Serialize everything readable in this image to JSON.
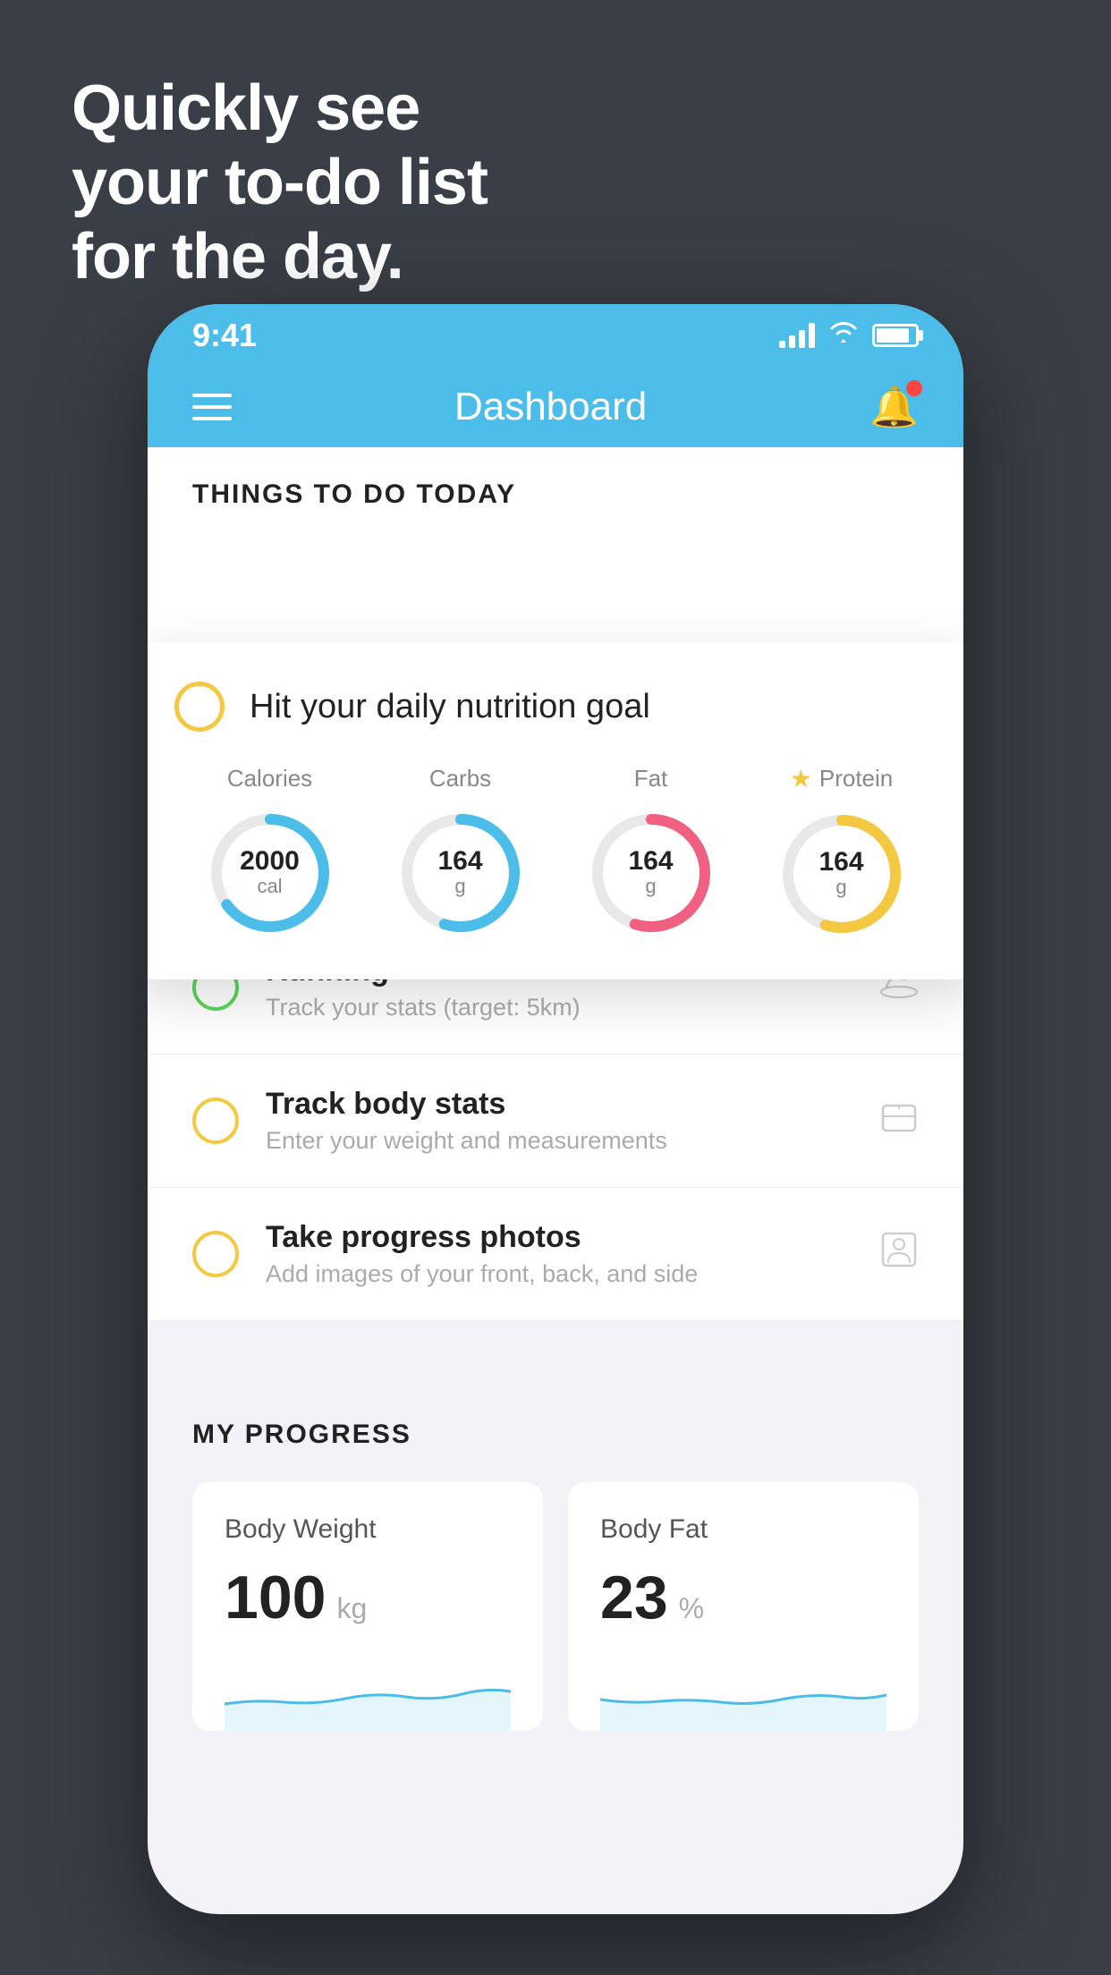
{
  "background_color": "#3a3f47",
  "headline": {
    "line1": "Quickly see",
    "line2": "your to-do list",
    "line3": "for the day."
  },
  "phone": {
    "status_bar": {
      "time": "9:41",
      "signal_label": "signal",
      "wifi_label": "wifi",
      "battery_label": "battery"
    },
    "nav_bar": {
      "menu_label": "menu",
      "title": "Dashboard",
      "bell_label": "notifications"
    },
    "section_header": "THINGS TO DO TODAY",
    "nutrition_card": {
      "circle_label": "incomplete",
      "title": "Hit your daily nutrition goal",
      "items": [
        {
          "label": "Calories",
          "value": "2000",
          "unit": "cal",
          "color": "#4bbde8",
          "percent": 65
        },
        {
          "label": "Carbs",
          "value": "164",
          "unit": "g",
          "color": "#4bbde8",
          "percent": 55
        },
        {
          "label": "Fat",
          "value": "164",
          "unit": "g",
          "color": "#f06080",
          "percent": 55
        },
        {
          "label": "Protein",
          "value": "164",
          "unit": "g",
          "color": "#f5c842",
          "percent": 55,
          "starred": true
        }
      ]
    },
    "todo_items": [
      {
        "id": "running",
        "title": "Running",
        "subtitle": "Track your stats (target: 5km)",
        "circle_color": "green",
        "icon": "👟"
      },
      {
        "id": "body-stats",
        "title": "Track body stats",
        "subtitle": "Enter your weight and measurements",
        "circle_color": "yellow",
        "icon": "⚖"
      },
      {
        "id": "photos",
        "title": "Take progress photos",
        "subtitle": "Add images of your front, back, and side",
        "circle_color": "yellow",
        "icon": "👤"
      }
    ],
    "my_progress": {
      "title": "MY PROGRESS",
      "cards": [
        {
          "id": "body-weight",
          "title": "Body Weight",
          "value": "100",
          "unit": "kg"
        },
        {
          "id": "body-fat",
          "title": "Body Fat",
          "value": "23",
          "unit": "%"
        }
      ]
    }
  }
}
